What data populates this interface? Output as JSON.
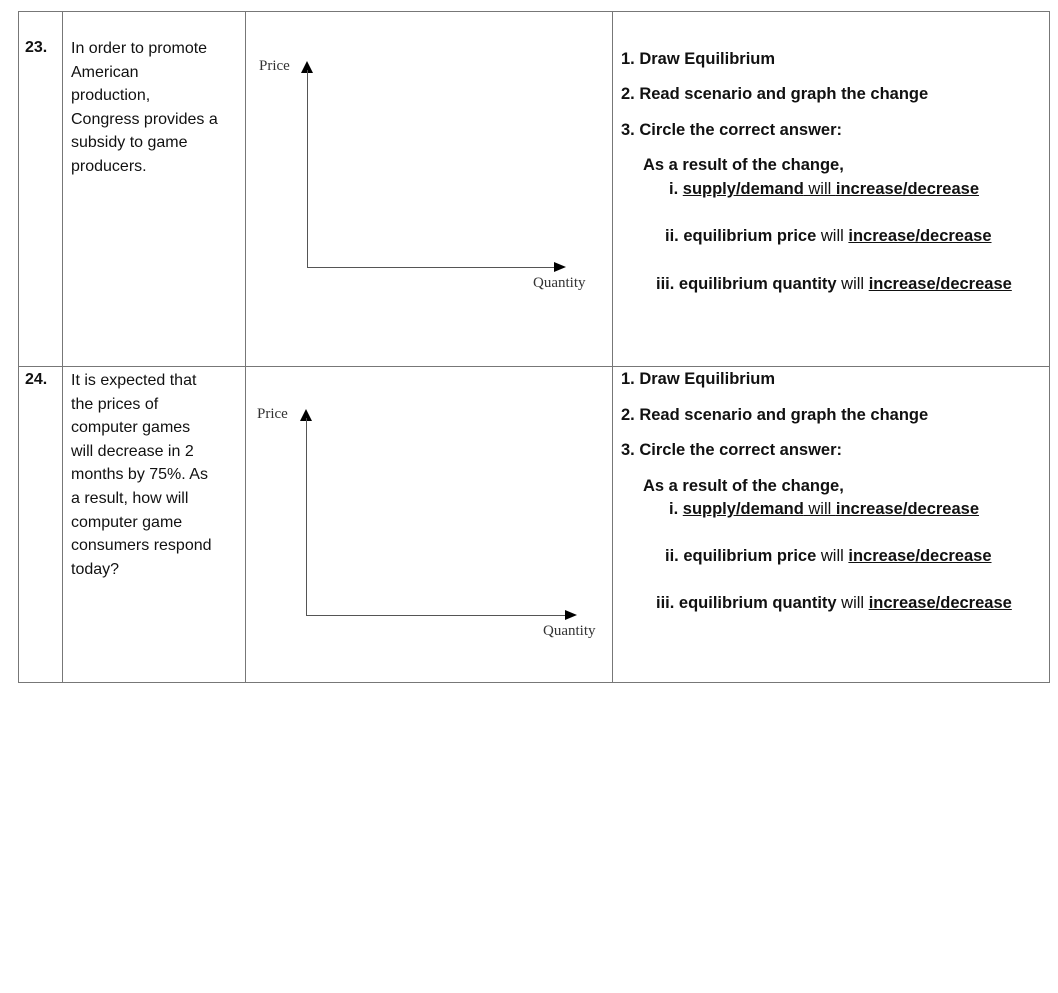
{
  "rows": [
    {
      "number": "23.",
      "scenario": [
        "In order to promote",
        "American",
        "production,",
        "Congress provides a",
        "subsidy to game",
        "producers."
      ],
      "graph": {
        "y_label": "Price",
        "x_label": "Quantity"
      }
    },
    {
      "number": "24.",
      "scenario": [
        "It is expected that",
        "the prices of",
        "computer games",
        "will decrease in 2",
        "months by 75%.  As",
        "a result, how will",
        "computer game",
        "consumers respond",
        "today?"
      ],
      "graph": {
        "y_label": "Price",
        "x_label": "Quantity"
      }
    }
  ],
  "instructions": {
    "step1": "1. Draw Equilibrium",
    "step2": "2. Read scenario and graph the change",
    "step3": "3. Circle the correct answer:",
    "intro": "As a result of the change,",
    "i_num": "i. ",
    "i_a": "supply/demand",
    "i_will": " will ",
    "i_b": "increase/decrease",
    "ii_num": "ii. ",
    "ii_a": "equilibrium price",
    "ii_will": " will ",
    "ii_b": "increase/decrease",
    "iii_num": "iii. ",
    "iii_a": "equilibrium quantity",
    "iii_will": " will ",
    "iii_b": "increase/decrease"
  }
}
